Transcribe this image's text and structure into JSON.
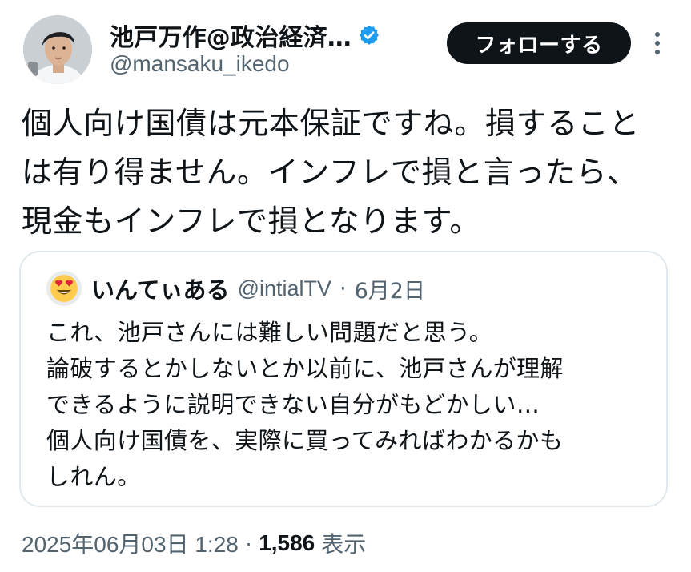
{
  "author": {
    "display_name": "池戸万作@政治経済…",
    "handle": "@mansaku_ikedo",
    "verified_icon": "verified-badge-icon",
    "accent": "#1d9bf0"
  },
  "actions": {
    "follow_label": "フォローする",
    "more_icon": "more-vertical-icon"
  },
  "tweet": {
    "text": "個人向け国債は元本保証ですね。損すること\nは有り得ません。インフレで損と言ったら、\n現金もインフレで損となります。"
  },
  "quote": {
    "avatar_icon": "heart-eyes-emoji",
    "display_name": "いんてぃある",
    "handle": "@intialTV",
    "separator": "·",
    "date": "6月2日",
    "text": "これ、池戸さんには難しい問題だと思う。\n論破するとかしないとか以前に、池戸さんが理解\nできるように説明できない自分がもどかしい…\n個人向け国債を、実際に買ってみればわかるかも\nしれん。"
  },
  "meta": {
    "timestamp": "2025年06月03日 1:28",
    "separator": "·",
    "views_count": "1,586",
    "views_label": "表示"
  }
}
